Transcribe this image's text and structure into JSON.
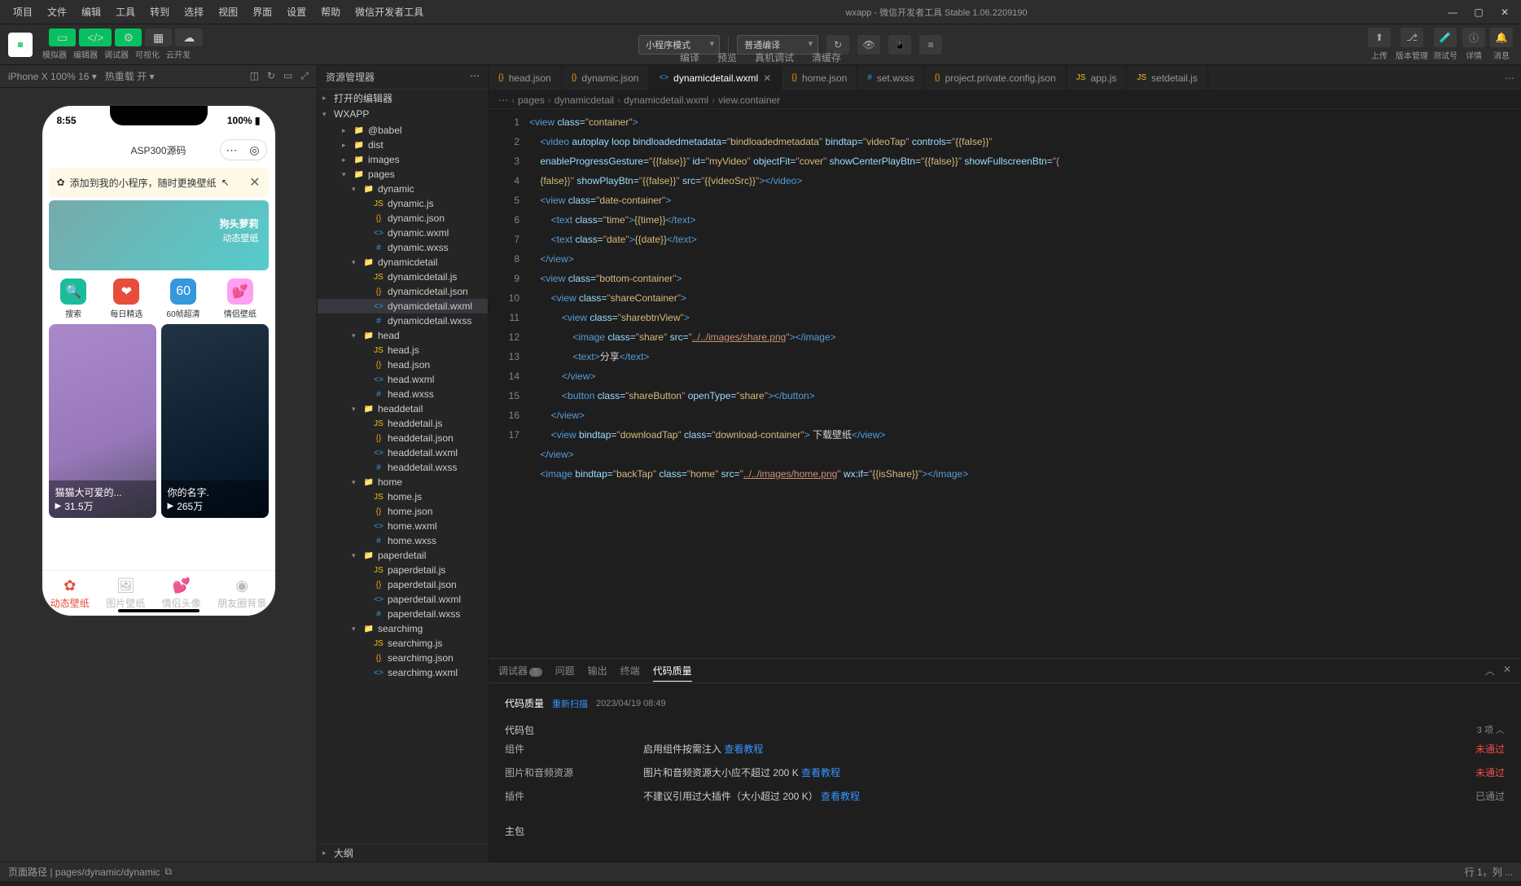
{
  "menu": [
    "项目",
    "文件",
    "编辑",
    "工具",
    "转到",
    "选择",
    "视图",
    "界面",
    "设置",
    "帮助",
    "微信开发者工具"
  ],
  "title_center": "wxapp - 微信开发者工具 Stable 1.06.2209190",
  "toolbar": {
    "labels": [
      "模拟器",
      "编辑器",
      "调试器",
      "可视化",
      "云开发"
    ],
    "mode": "小程序模式",
    "compile": "普通编译",
    "actions": [
      "编译",
      "预览",
      "真机调试",
      "清缓存"
    ],
    "right": [
      "上传",
      "版本管理",
      "测试号",
      "详情",
      "消息"
    ]
  },
  "sim": {
    "device": "iPhone X 100% 16 ▾",
    "hot": "热重载 开 ▾",
    "time": "8:55",
    "battery": "100%",
    "app_title": "ASP300源码",
    "banner": "添加到我的小程序，随时更换壁纸",
    "hero_title": "狗头萝莉",
    "hero_sub": "动态壁纸",
    "quick": [
      "搜索",
      "每日精选",
      "60帧超清",
      "情侣壁纸"
    ],
    "card1_title": "猫猫大可爱的...",
    "card1_stat": "31.5万",
    "card2_title": "你的名字.",
    "card2_stat": "265万",
    "tabs": [
      "动态壁纸",
      "图片壁纸",
      "情侣头像",
      "朋友圈背景"
    ]
  },
  "explorer": {
    "title": "资源管理器",
    "sections": [
      "打开的编辑器",
      "WXAPP"
    ],
    "tree": [
      {
        "l": 2,
        "t": "folder",
        "n": "@babel"
      },
      {
        "l": 2,
        "t": "folder",
        "n": "dist"
      },
      {
        "l": 2,
        "t": "folder",
        "n": "images"
      },
      {
        "l": 2,
        "t": "folder",
        "n": "pages",
        "open": true
      },
      {
        "l": 3,
        "t": "folder",
        "n": "dynamic",
        "open": true
      },
      {
        "l": 4,
        "t": "js",
        "n": "dynamic.js"
      },
      {
        "l": 4,
        "t": "json",
        "n": "dynamic.json"
      },
      {
        "l": 4,
        "t": "wxml",
        "n": "dynamic.wxml"
      },
      {
        "l": 4,
        "t": "wxss",
        "n": "dynamic.wxss"
      },
      {
        "l": 3,
        "t": "folder",
        "n": "dynamicdetail",
        "open": true
      },
      {
        "l": 4,
        "t": "js",
        "n": "dynamicdetail.js"
      },
      {
        "l": 4,
        "t": "json",
        "n": "dynamicdetail.json"
      },
      {
        "l": 4,
        "t": "wxml",
        "n": "dynamicdetail.wxml",
        "active": true
      },
      {
        "l": 4,
        "t": "wxss",
        "n": "dynamicdetail.wxss"
      },
      {
        "l": 3,
        "t": "folder",
        "n": "head",
        "open": true
      },
      {
        "l": 4,
        "t": "js",
        "n": "head.js"
      },
      {
        "l": 4,
        "t": "json",
        "n": "head.json"
      },
      {
        "l": 4,
        "t": "wxml",
        "n": "head.wxml"
      },
      {
        "l": 4,
        "t": "wxss",
        "n": "head.wxss"
      },
      {
        "l": 3,
        "t": "folder",
        "n": "headdetail",
        "open": true
      },
      {
        "l": 4,
        "t": "js",
        "n": "headdetail.js"
      },
      {
        "l": 4,
        "t": "json",
        "n": "headdetail.json"
      },
      {
        "l": 4,
        "t": "wxml",
        "n": "headdetail.wxml"
      },
      {
        "l": 4,
        "t": "wxss",
        "n": "headdetail.wxss"
      },
      {
        "l": 3,
        "t": "folder",
        "n": "home",
        "open": true
      },
      {
        "l": 4,
        "t": "js",
        "n": "home.js"
      },
      {
        "l": 4,
        "t": "json",
        "n": "home.json"
      },
      {
        "l": 4,
        "t": "wxml",
        "n": "home.wxml"
      },
      {
        "l": 4,
        "t": "wxss",
        "n": "home.wxss"
      },
      {
        "l": 3,
        "t": "folder",
        "n": "paperdetail",
        "open": true
      },
      {
        "l": 4,
        "t": "js",
        "n": "paperdetail.js"
      },
      {
        "l": 4,
        "t": "json",
        "n": "paperdetail.json"
      },
      {
        "l": 4,
        "t": "wxml",
        "n": "paperdetail.wxml"
      },
      {
        "l": 4,
        "t": "wxss",
        "n": "paperdetail.wxss"
      },
      {
        "l": 3,
        "t": "folder",
        "n": "searchimg",
        "open": true
      },
      {
        "l": 4,
        "t": "js",
        "n": "searchimg.js"
      },
      {
        "l": 4,
        "t": "json",
        "n": "searchimg.json"
      },
      {
        "l": 4,
        "t": "wxml",
        "n": "searchimg.wxml"
      }
    ],
    "outline": "大纲"
  },
  "tabs": [
    {
      "icon": "json",
      "n": "head.json"
    },
    {
      "icon": "json",
      "n": "dynamic.json"
    },
    {
      "icon": "wxml",
      "n": "dynamicdetail.wxml",
      "active": true,
      "dirty": true
    },
    {
      "icon": "json",
      "n": "home.json"
    },
    {
      "icon": "wxss",
      "n": "set.wxss"
    },
    {
      "icon": "json",
      "n": "project.private.config.json"
    },
    {
      "icon": "js",
      "n": "app.js"
    },
    {
      "icon": "js",
      "n": "setdetail.js"
    }
  ],
  "breadcrumb": [
    "⋯",
    "pages",
    "dynamicdetail",
    "dynamicdetail.wxml",
    "view.container"
  ],
  "code_lines": [
    1,
    2,
    3,
    4,
    5,
    6,
    7,
    8,
    9,
    10,
    11,
    12,
    13,
    14,
    15,
    16,
    17
  ],
  "panel": {
    "tabs": [
      "调试器",
      "问题",
      "输出",
      "终端",
      "代码质量"
    ],
    "badge": "5",
    "title": "代码质量",
    "rescan": "重新扫描",
    "date": "2023/04/19 08:49",
    "section": "代码包",
    "count": "3 项 ︿",
    "rows": [
      {
        "k": "组件",
        "v": "启用组件按需注入 ",
        "link": "查看教程",
        "status": "未通过"
      },
      {
        "k": "图片和音频资源",
        "v": "图片和音频资源大小应不超过 200 K ",
        "link": "查看教程",
        "status": "未通过"
      },
      {
        "k": "插件",
        "v": "不建议引用过大插件（大小超过 200 K）  ",
        "link": "查看教程",
        "status": "已通过",
        "pass": true
      }
    ],
    "section2": "主包"
  },
  "status": {
    "left": "页面路径  |  pages/dynamic/dynamic",
    "right": [
      "行 1，列 ..."
    ]
  },
  "download_text": "下载壁纸",
  "share_text": "分享"
}
